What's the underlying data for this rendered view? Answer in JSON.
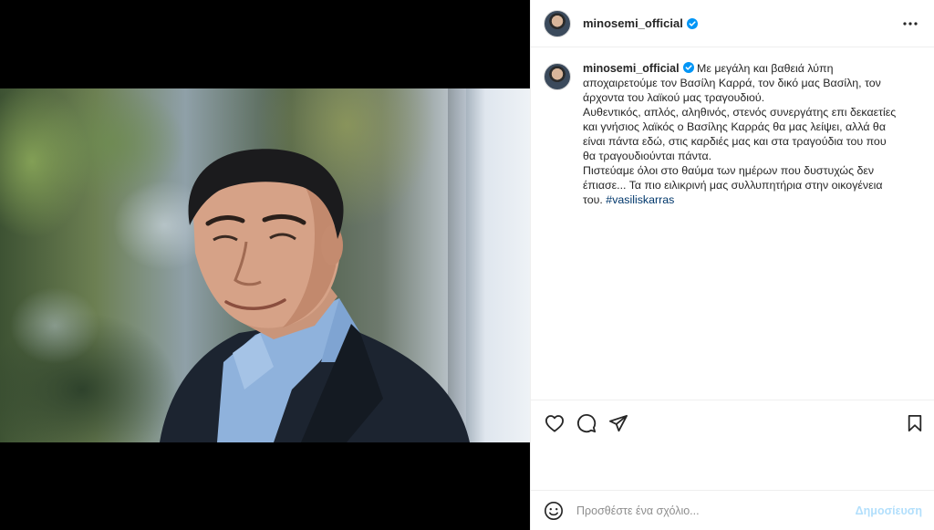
{
  "post": {
    "username": "minosemi_official",
    "verified": true,
    "caption_lines": [
      "Με μεγάλη και βαθειά λύπη αποχαιρετούμε τον Βασίλη Καρρά, τον δικό μας Βασίλη, τον άρχοντα του λαϊκού μας τραγουδιού.",
      "Αυθεντικός, απλός, αληθινός, στενός συνεργάτης επι δεκαετίες και γνήσιος λαϊκός ο Βασίλης Καρράς θα μας λείψει, αλλά θα είναι πάντα εδώ, στις καρδιές μας και στα τραγούδια του που θα τραγουδιούνται πάντα.",
      "Πιστεύαμε όλοι στο θαύμα των ημέρων που δυστυχώς δεν έπιασε... Τα πιο ειλικρινή μας συλλυπητήρια στην οικογένεια του."
    ],
    "hashtag": "#vasiliskarras"
  },
  "comment": {
    "placeholder": "Προσθέστε ένα σχόλιο...",
    "post_label": "Δημοσίευση"
  },
  "icons": {
    "more": "more-options-icon",
    "like": "heart-icon",
    "comment": "comment-icon",
    "share": "send-icon",
    "save": "bookmark-icon",
    "emoji": "emoji-icon",
    "verified": "verified-badge-icon"
  },
  "colors": {
    "verified_blue": "#0095f6",
    "hashtag": "#00376b",
    "post_button_disabled": "#b2dffc"
  }
}
